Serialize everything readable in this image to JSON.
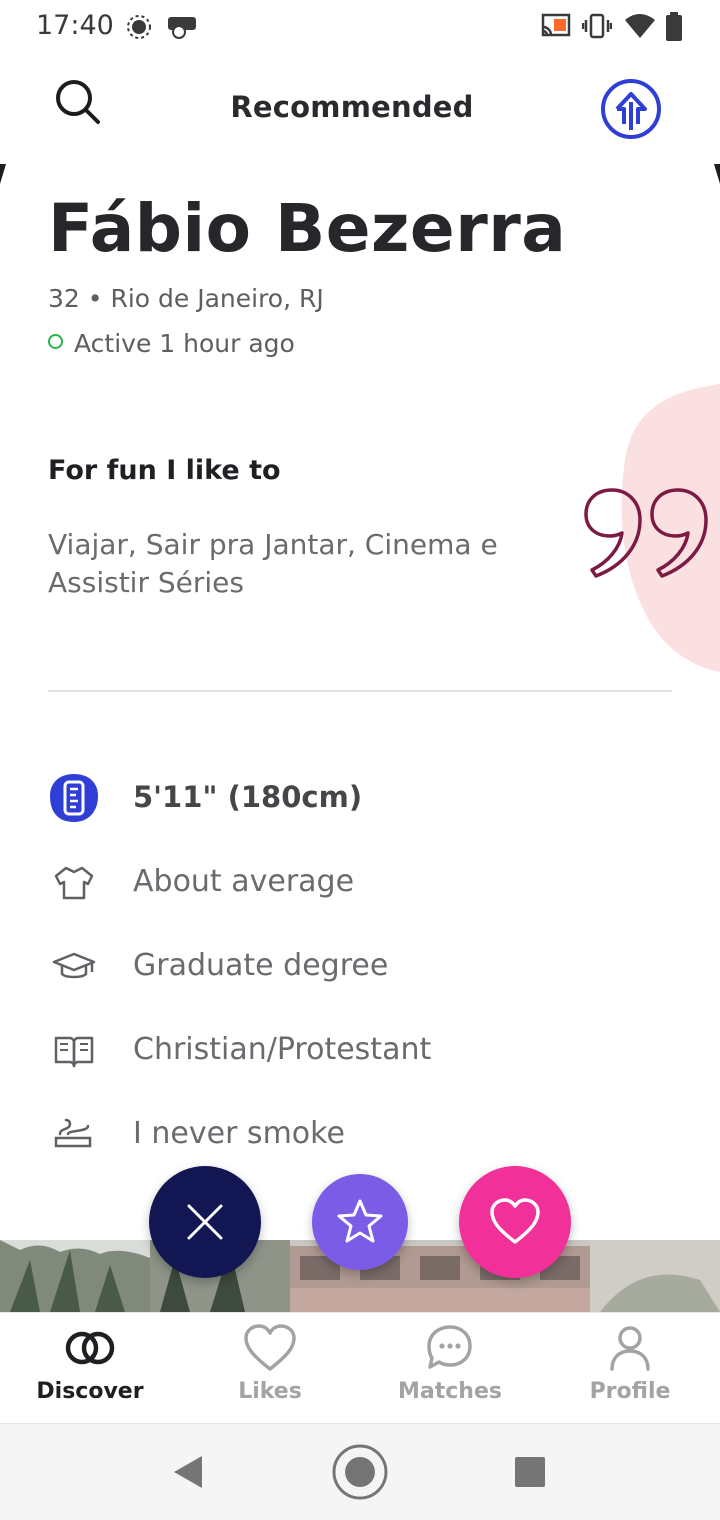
{
  "status_bar": {
    "time": "17:40",
    "left_icons": [
      "brightness-icon",
      "chat-bubble-icon"
    ],
    "right_icons": [
      "cast-icon",
      "vibrate-icon",
      "wifi-icon",
      "battery-icon"
    ]
  },
  "header": {
    "title": "Recommended",
    "search_icon": "search-icon",
    "boost_icon": "boost-icon"
  },
  "profile": {
    "name": "Fábio Bezerra",
    "meta": "32 • Rio de Janeiro, RJ",
    "active": "Active 1 hour ago"
  },
  "prompt": {
    "title": "For fun I like to",
    "answer": "Viajar, Sair pra Jantar, Cinema e Assistir Séries"
  },
  "details": [
    {
      "icon": "ruler-icon",
      "text": "5'11\" (180cm)"
    },
    {
      "icon": "shirt-icon",
      "text": "About average"
    },
    {
      "icon": "graduation-cap-icon",
      "text": "Graduate degree"
    },
    {
      "icon": "book-icon",
      "text": "Christian/Protestant"
    },
    {
      "icon": "smoke-icon",
      "text": "I never smoke"
    }
  ],
  "actions": {
    "pass_icon": "close-icon",
    "super_icon": "star-icon",
    "like_icon": "heart-icon"
  },
  "bottom_nav": [
    {
      "label": "Discover",
      "icon": "discover-rings-icon",
      "active": true
    },
    {
      "label": "Likes",
      "icon": "heart-outline-icon",
      "active": false
    },
    {
      "label": "Matches",
      "icon": "chat-icon",
      "active": false
    },
    {
      "label": "Profile",
      "icon": "person-icon",
      "active": false
    }
  ],
  "colors": {
    "accent_blue": "#2f3fd6",
    "pass": "#121653",
    "super": "#7a5ce6",
    "like": "#f2309a",
    "quote": "#7d1a44",
    "blob": "#fbe0e2",
    "online": "#2cb34a"
  }
}
